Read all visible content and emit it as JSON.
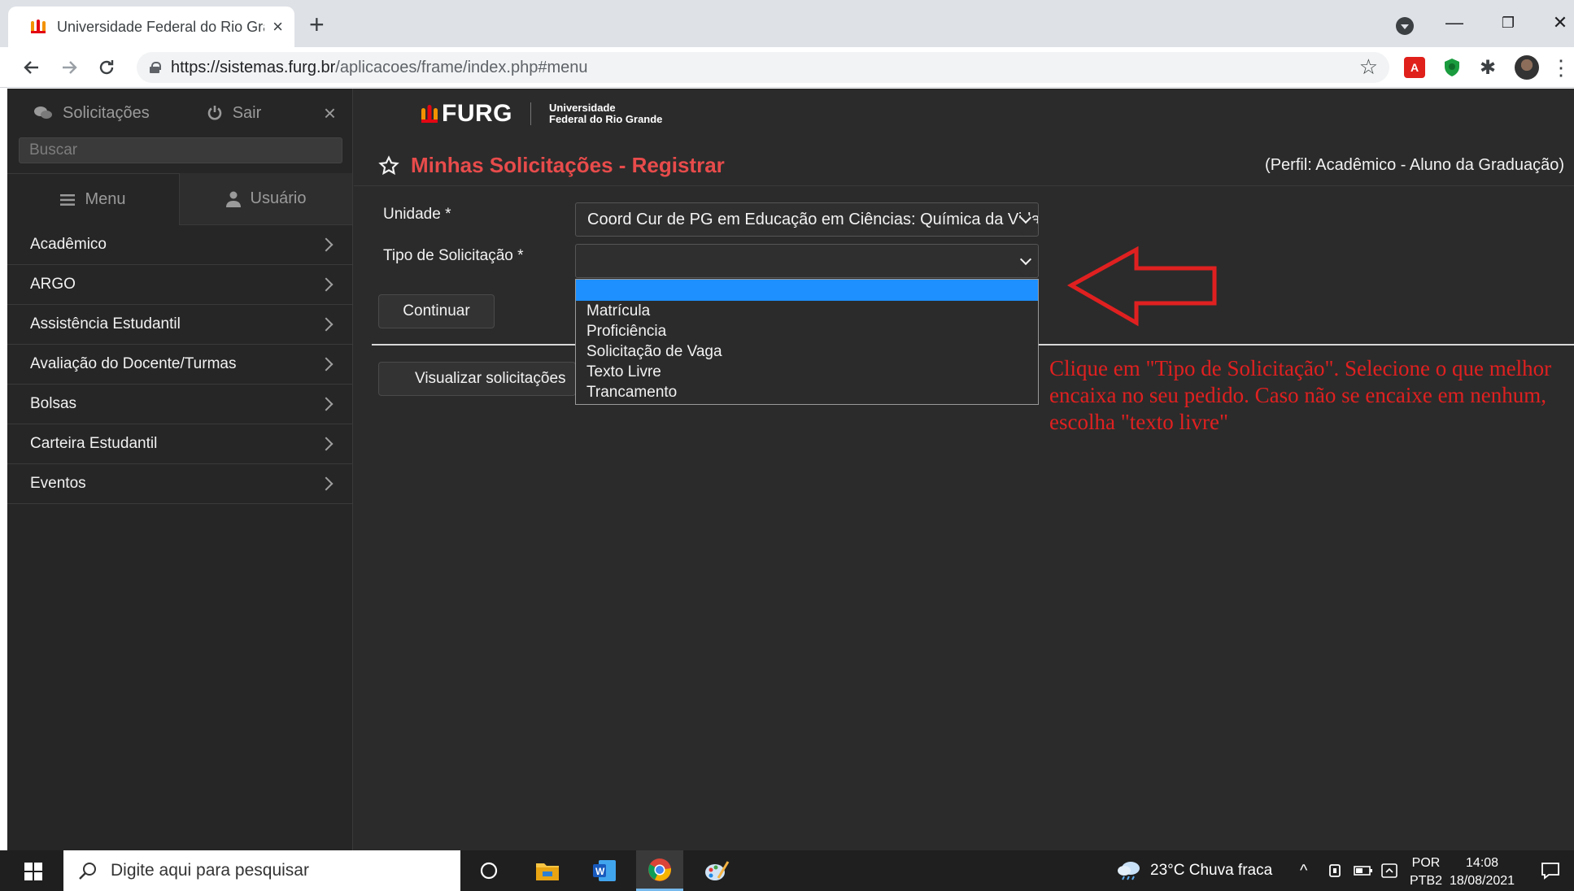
{
  "browser": {
    "tab_title": "Universidade Federal do Rio Grande",
    "tab_close": "×",
    "new_tab": "+",
    "url_host": "https://sistemas.furg.br",
    "url_path": "/aplicacoes/frame/index.php#menu",
    "window_minimize": "—",
    "window_restore": "❐",
    "window_close": "✕",
    "ext_pdf": "A"
  },
  "sidebar": {
    "top_links": [
      "Solicitações",
      "Sair"
    ],
    "close": "×",
    "search_placeholder": "Buscar",
    "tabs": [
      "Menu",
      "Usuário"
    ],
    "items": [
      {
        "label": "Acadêmico"
      },
      {
        "label": "ARGO"
      },
      {
        "label": "Assistência Estudantil"
      },
      {
        "label": "Avaliação do Docente/Turmas"
      },
      {
        "label": "Bolsas"
      },
      {
        "label": "Carteira Estudantil"
      },
      {
        "label": "Eventos"
      }
    ]
  },
  "header": {
    "logo_text": "FURG",
    "logo_sub_1": "Universidade",
    "logo_sub_2": "Federal do Rio Grande"
  },
  "main": {
    "title": "Minhas Solicitações - Registrar",
    "perfil": "(Perfil: Acadêmico - Aluno da Graduação)",
    "unidade_label": "Unidade",
    "unidade_value": "Coord Cur de PG em Educação em Ciências: Química da Vida e Saúde",
    "tipo_label": "Tipo de Solicitação",
    "required_mark": "*",
    "tipo_value": "",
    "continue_label": "Continuar",
    "view_label": "Visualizar solicitações",
    "dropdown_options": [
      "",
      "Matrícula",
      "Proficiência",
      "Solicitação de Vaga",
      "Texto Livre",
      "Trancamento"
    ]
  },
  "annotation": {
    "note": "Clique em \"Tipo de Solicitação\". Selecione o que melhor encaixa no seu pedido. Caso não se encaixe em nenhum, escolha \"texto livre\"",
    "color": "#e02020"
  },
  "taskbar": {
    "search_placeholder": "Digite aqui para pesquisar",
    "weather": "23°C  Chuva fraca",
    "lang_1": "POR",
    "lang_2": "PTB2",
    "time": "14:08",
    "date": "18/08/2021"
  },
  "colors": {
    "accent_title": "#e84b4b",
    "selected_option": "#1e90ff",
    "page_bg": "#2b2b2b"
  }
}
